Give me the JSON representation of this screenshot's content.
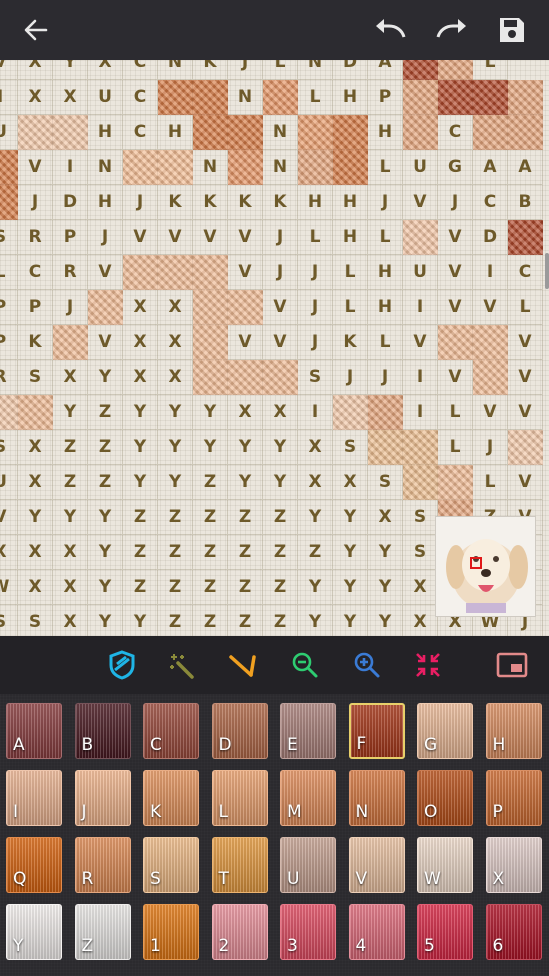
{
  "header": {
    "back_icon": "arrow-left-icon",
    "undo_icon": "undo-icon",
    "redo_icon": "redo-icon",
    "save_icon": "save-icon"
  },
  "toolbar": {
    "tools": [
      {
        "name": "fill-tool",
        "icon": "shield-icon",
        "color": "#1fb5e6"
      },
      {
        "name": "magic-wand-tool",
        "icon": "magic-wand-icon",
        "color": "#9a9a3a"
      },
      {
        "name": "needle-tool",
        "icon": "needle-icon",
        "color": "#f0a020"
      },
      {
        "name": "zoom-out-tool",
        "icon": "zoom-out-icon",
        "color": "#2ecc71"
      },
      {
        "name": "zoom-in-tool",
        "icon": "zoom-in-icon",
        "color": "#3a7bd5"
      },
      {
        "name": "fit-screen-tool",
        "icon": "collapse-arrows-icon",
        "color": "#e91e63"
      },
      {
        "name": "minimap-toggle",
        "icon": "picture-in-picture-icon",
        "color": "#e28a8a"
      }
    ]
  },
  "grid": {
    "letter_color": "#6e5a2a",
    "stitch_colors": {
      "F": "#b0482a",
      "G": "#f2c4a4",
      "H": "#e4a47c",
      "I": "#f2c8a8",
      "J": "#efba94",
      "K": "#e49464",
      "L": "#e89c6c",
      "M": "#f2bc94",
      "N": "#d57b47",
      "O": "#b94e1e",
      "P": "#c6602e",
      "R": "#e2965e",
      "S": "#ebbd8f"
    },
    "rows": [
      "VXYXCNKJLNDAFCL",
      "IXXUCNNNKLHPCFFH",
      "UIIHCHNNNLNHHCBD",
      "NVINMMNKNHNLUGAA",
      "NJDHJKKKKHHJVJCB",
      "SRPJVVVVJLHLGVDF",
      "LCRVJJJVJJLHUVIC",
      "PPJJXXJJVJLHIVVL",
      "PKJVXXJVVJKLVJJV",
      "RSXYXXJJJSJJIVJV",
      "IJYZYYYXXIIVILVV",
      "SXZZYYYYYXSSSLJI",
      "UXZZYYZYYXXSSJLV",
      "VYYYZZZZZYYXSZZV",
      "XXXYZZZZZZYYSXXX",
      "WXXYZZZZZYYYXXXX",
      "SSXYYZZZZYYYXXWJ"
    ],
    "stitched": [
      "000000000000110",
      "0000011010001111",
      "0110001101101011",
      "1000110101100000",
      "1000000000000000",
      "0000000000001001",
      "0000111000000000",
      "0001001100000000",
      "0010001000000110",
      "0000001110000010",
      "1100000000110000",
      "0000000000011001",
      "0000000000001100",
      "0000000000000100",
      "0000000000000100",
      "0000000000000100",
      "0000000000000000"
    ]
  },
  "minimap": {
    "visible": true,
    "image": "golden-retriever-dog-thumbnail"
  },
  "palette": [
    {
      "label": "A",
      "color": "#8a3e40"
    },
    {
      "label": "B",
      "color": "#4a1a22"
    },
    {
      "label": "C",
      "color": "#9a4a3c"
    },
    {
      "label": "D",
      "color": "#b06848"
    },
    {
      "label": "E",
      "color": "#a9807a"
    },
    {
      "label": "F",
      "color": "#a8381a"
    },
    {
      "label": "G",
      "color": "#e9b896"
    },
    {
      "label": "H",
      "color": "#d98d60"
    },
    {
      "label": "I",
      "color": "#e9b290"
    },
    {
      "label": "J",
      "color": "#efb48c"
    },
    {
      "label": "K",
      "color": "#e2925c"
    },
    {
      "label": "L",
      "color": "#e9a06e"
    },
    {
      "label": "M",
      "color": "#e08c5a"
    },
    {
      "label": "N",
      "color": "#d4763f"
    },
    {
      "label": "O",
      "color": "#b8501a"
    },
    {
      "label": "P",
      "color": "#cc6a30"
    },
    {
      "label": "Q",
      "color": "#d86410"
    },
    {
      "label": "R",
      "color": "#dd8a54"
    },
    {
      "label": "S",
      "color": "#ecb884"
    },
    {
      "label": "T",
      "color": "#e49a40"
    },
    {
      "label": "U",
      "color": "#c4a090"
    },
    {
      "label": "V",
      "color": "#e8c0a0"
    },
    {
      "label": "W",
      "color": "#ecd8c8"
    },
    {
      "label": "X",
      "color": "#e0ccc8"
    },
    {
      "label": "Y",
      "color": "#f2eeec"
    },
    {
      "label": "Z",
      "color": "#e8e6e4"
    },
    {
      "label": "1",
      "color": "#e27814"
    },
    {
      "label": "2",
      "color": "#e8909a"
    },
    {
      "label": "3",
      "color": "#e04c62"
    },
    {
      "label": "4",
      "color": "#de6a7a"
    },
    {
      "label": "5",
      "color": "#d82846"
    },
    {
      "label": "6",
      "color": "#b01428"
    }
  ],
  "selected_color": "F"
}
